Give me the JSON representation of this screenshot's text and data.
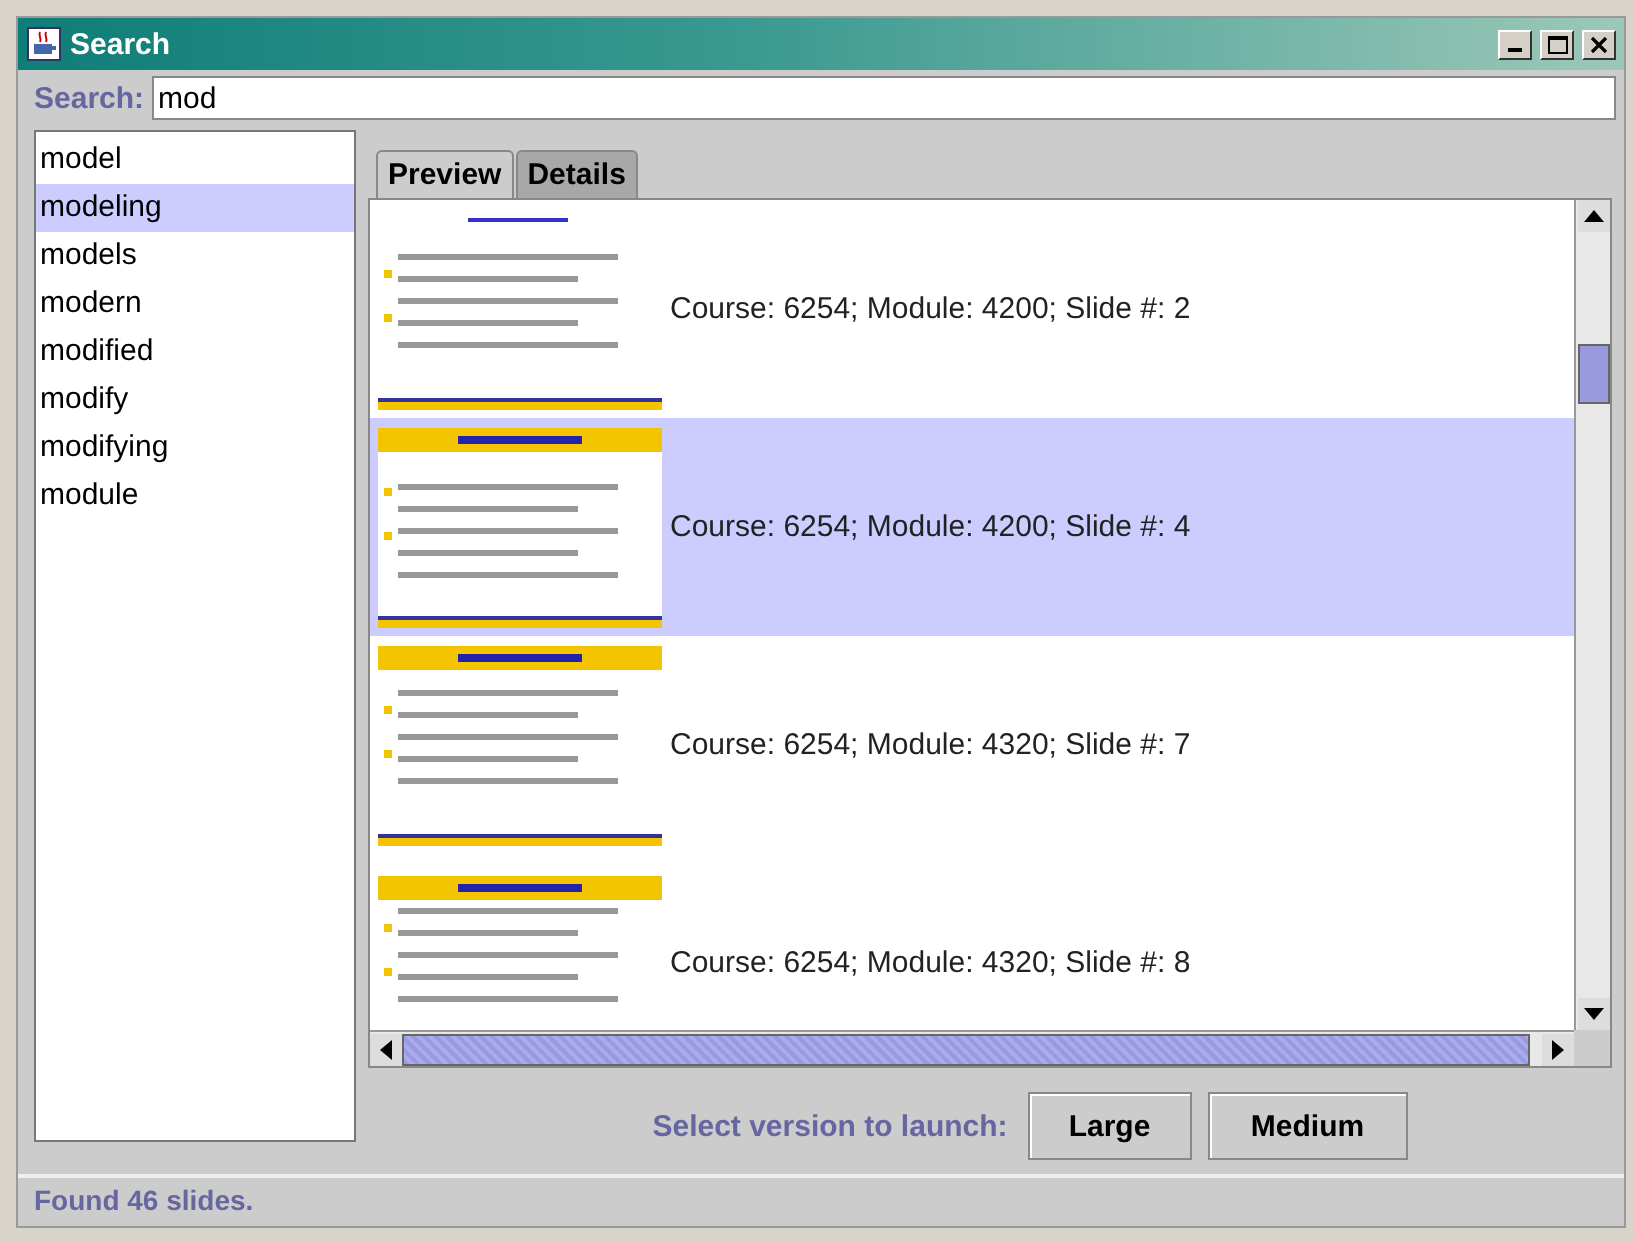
{
  "window": {
    "title": "Search"
  },
  "search": {
    "label": "Search:",
    "value": "mod"
  },
  "words": [
    {
      "label": "model",
      "selected": false
    },
    {
      "label": "modeling",
      "selected": true
    },
    {
      "label": "models",
      "selected": false
    },
    {
      "label": "modern",
      "selected": false
    },
    {
      "label": "modified",
      "selected": false
    },
    {
      "label": "modify",
      "selected": false
    },
    {
      "label": "modifying",
      "selected": false
    },
    {
      "label": "module",
      "selected": false
    }
  ],
  "tabs": [
    {
      "label": "Preview",
      "selected": true
    },
    {
      "label": "Details",
      "selected": false
    }
  ],
  "results": [
    {
      "caption": "Course: 6254; Module: 4200; Slide #: 2",
      "selected": false
    },
    {
      "caption": "Course: 6254; Module: 4200; Slide #: 4",
      "selected": true
    },
    {
      "caption": "Course: 6254; Module: 4320; Slide #: 7",
      "selected": false
    },
    {
      "caption": "Course: 6254; Module: 4320; Slide #: 8",
      "selected": false
    }
  ],
  "launch": {
    "label": "Select version to launch:",
    "buttons": [
      "Large",
      "Medium"
    ]
  },
  "status_bar": "Found 46 slides."
}
